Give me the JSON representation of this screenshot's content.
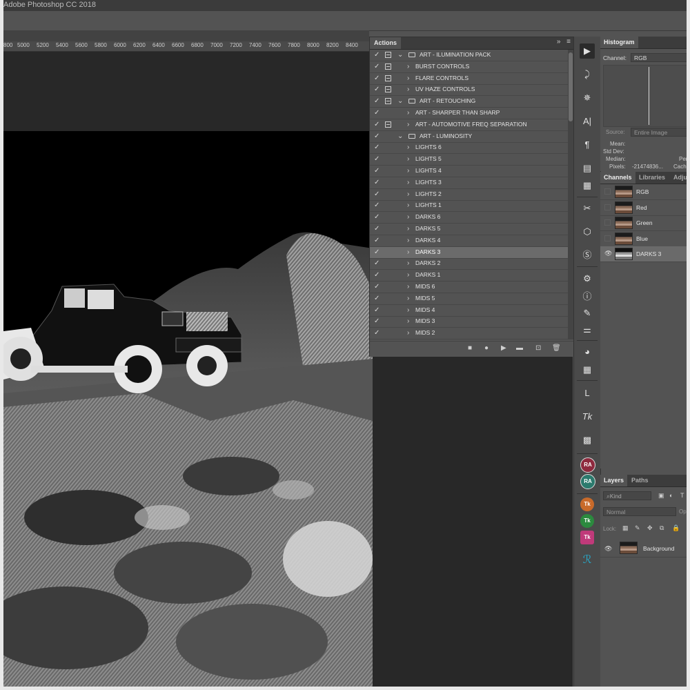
{
  "app": {
    "title": "Adobe Photoshop CC 2018"
  },
  "ruler": {
    "ticks": [
      "800",
      "5000",
      "5200",
      "5400",
      "5600",
      "5800",
      "6000",
      "6200",
      "6400",
      "6600",
      "6800",
      "7000",
      "7200",
      "7400",
      "7600",
      "7800",
      "8000",
      "8200",
      "8400"
    ]
  },
  "actions_panel": {
    "title": "Actions",
    "collapse_glyph": "»",
    "menu_glyph": "≡",
    "rows": [
      {
        "label": "ART -  ILUMINATION PACK",
        "kind": "set",
        "expanded": true,
        "toggle": true
      },
      {
        "label": "BURST CONTROLS",
        "kind": "action",
        "toggle": true
      },
      {
        "label": "FLARE CONTROLS",
        "kind": "action",
        "toggle": true
      },
      {
        "label": "UV HAZE CONTROLS",
        "kind": "action",
        "toggle": true
      },
      {
        "label": "ART - RETOUCHING",
        "kind": "set",
        "expanded": true,
        "toggle": true
      },
      {
        "label": "ART - SHARPER THAN SHARP",
        "kind": "action",
        "toggle": false
      },
      {
        "label": "ART - AUTOMOTIVE FREQ SEPARATION",
        "kind": "action",
        "toggle": true
      },
      {
        "label": "ART - LUMINOSITY",
        "kind": "set",
        "expanded": true,
        "toggle": false
      },
      {
        "label": "LIGHTS 6",
        "kind": "action",
        "toggle": false
      },
      {
        "label": "LIGHTS 5",
        "kind": "action",
        "toggle": false
      },
      {
        "label": "LIGHTS 4",
        "kind": "action",
        "toggle": false
      },
      {
        "label": "LIGHTS 3",
        "kind": "action",
        "toggle": false
      },
      {
        "label": "LIGHTS 2",
        "kind": "action",
        "toggle": false
      },
      {
        "label": "LIGHTS 1",
        "kind": "action",
        "toggle": false
      },
      {
        "label": "DARKS 6",
        "kind": "action",
        "toggle": false
      },
      {
        "label": "DARKS 5",
        "kind": "action",
        "toggle": false
      },
      {
        "label": "DARKS 4",
        "kind": "action",
        "toggle": false
      },
      {
        "label": "DARKS 3",
        "kind": "action",
        "toggle": false,
        "selected": true
      },
      {
        "label": "DARKS 2",
        "kind": "action",
        "toggle": false
      },
      {
        "label": "DARKS 1",
        "kind": "action",
        "toggle": false
      },
      {
        "label": "MIDS 6",
        "kind": "action",
        "toggle": false
      },
      {
        "label": "MIDS 5",
        "kind": "action",
        "toggle": false
      },
      {
        "label": "MIDS 4",
        "kind": "action",
        "toggle": false
      },
      {
        "label": "MIDS 3",
        "kind": "action",
        "toggle": false
      },
      {
        "label": "MIDS 2",
        "kind": "action",
        "toggle": false
      }
    ],
    "footer_icons": [
      "stop-icon",
      "record-icon",
      "play-icon",
      "new-set-icon",
      "new-action-icon",
      "trash-icon"
    ]
  },
  "histogram_panel": {
    "title": "Histogram",
    "channel_label": "Channel:",
    "channel_value": "RGB",
    "source_label": "Source:",
    "source_value": "Entire Image",
    "mean_label": "Mean:",
    "stddev_label": "Std Dev:",
    "median_label": "Median:",
    "pixels_label": "Pixels:",
    "pixels_value": "-21474836...",
    "perc_label": "Perc",
    "cache_label": "Cache"
  },
  "channels_panel": {
    "tabs": [
      "Channels",
      "Libraries",
      "Adjus"
    ],
    "channels": [
      {
        "name": "RGB",
        "visible": false
      },
      {
        "name": "Red",
        "visible": false
      },
      {
        "name": "Green",
        "visible": false
      },
      {
        "name": "Blue",
        "visible": false
      },
      {
        "name": "DARKS 3",
        "visible": true,
        "selected": true
      }
    ]
  },
  "layers_panel": {
    "tabs": [
      "Layers",
      "Paths"
    ],
    "kind_placeholder": "Kind",
    "blend_mode": "Normal",
    "opacity_label": "Opa",
    "lock_label": "Lock:",
    "layers": [
      {
        "name": "Background",
        "visible": true
      }
    ]
  },
  "dock": {
    "ra_label": "RA",
    "tk_label": "Tk",
    "l_label": "L",
    "colors": {
      "ra1": "#8e2a3e",
      "ra2": "#2c7a6d",
      "tk1": "#c86a2a",
      "tk2": "#2b8a3e",
      "tk3": "#c03a7a",
      "accent": "#28a8c8"
    }
  }
}
